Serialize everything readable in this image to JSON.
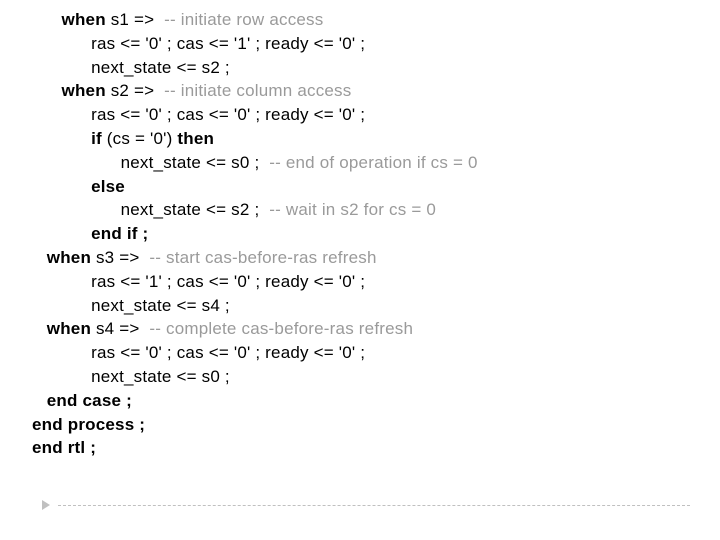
{
  "lines": [
    {
      "indent": 2,
      "parts": [
        {
          "t": "when ",
          "b": true
        },
        {
          "t": "s1 => "
        },
        {
          "t": " -- initiate row access",
          "c": true
        }
      ]
    },
    {
      "indent": 4,
      "parts": [
        {
          "t": "ras <= '0' ; cas <= '1' ; ready <= '0' ;"
        }
      ]
    },
    {
      "indent": 4,
      "parts": [
        {
          "t": "next_state <= s2 ;"
        }
      ]
    },
    {
      "indent": 2,
      "parts": [
        {
          "t": "when ",
          "b": true
        },
        {
          "t": "s2 =>  "
        },
        {
          "t": "-- initiate column access",
          "c": true
        }
      ]
    },
    {
      "indent": 4,
      "parts": [
        {
          "t": "ras <= '0' ; cas <= '0' ; ready <= '0' ;"
        }
      ]
    },
    {
      "indent": 4,
      "parts": [
        {
          "t": "if ",
          "b": true
        },
        {
          "t": "(cs = '0') "
        },
        {
          "t": "then",
          "b": true
        }
      ]
    },
    {
      "indent": 6,
      "parts": [
        {
          "t": "next_state <= s0 ;  "
        },
        {
          "t": "-- end of operation if cs = 0",
          "c": true
        }
      ]
    },
    {
      "indent": 4,
      "parts": [
        {
          "t": "else",
          "b": true
        }
      ]
    },
    {
      "indent": 6,
      "parts": [
        {
          "t": "next_state <= s2 ;  "
        },
        {
          "t": "-- wait in s2 for cs = 0",
          "c": true
        }
      ]
    },
    {
      "indent": 4,
      "parts": [
        {
          "t": "end if ;",
          "b": true
        }
      ]
    },
    {
      "indent": 1,
      "parts": [
        {
          "t": "when ",
          "b": true
        },
        {
          "t": "s3 => "
        },
        {
          "t": " -- start cas-before-ras refresh",
          "c": true
        }
      ]
    },
    {
      "indent": 4,
      "parts": [
        {
          "t": "ras <= '1' ; cas <= '0' ; ready <= '0' ;"
        }
      ]
    },
    {
      "indent": 4,
      "parts": [
        {
          "t": "next_state <= s4 ;"
        }
      ]
    },
    {
      "indent": 1,
      "parts": [
        {
          "t": "when ",
          "b": true
        },
        {
          "t": "s4 => "
        },
        {
          "t": " -- complete cas-before-ras refresh",
          "c": true
        }
      ]
    },
    {
      "indent": 4,
      "parts": [
        {
          "t": "ras <= '0' ; cas <= '0' ; ready <= '0' ;"
        }
      ]
    },
    {
      "indent": 4,
      "parts": [
        {
          "t": "next_state <= s0 ;"
        }
      ]
    },
    {
      "indent": 1,
      "parts": [
        {
          "t": "end case ;",
          "b": true
        }
      ]
    },
    {
      "indent": 0,
      "parts": [
        {
          "t": "end process ;",
          "b": true
        }
      ]
    },
    {
      "indent": 0,
      "parts": [
        {
          "t": "end rtl ;",
          "b": true
        }
      ]
    }
  ]
}
